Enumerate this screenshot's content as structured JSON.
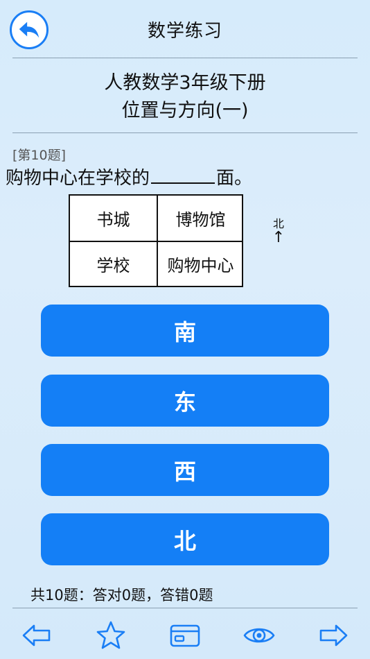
{
  "nav": {
    "title": "数学练习",
    "back_icon": "back-arrow-icon"
  },
  "book": {
    "line1": "人教数学3年级下册",
    "line2": "位置与方向(一)"
  },
  "question": {
    "number": "[第10题]",
    "text_before": "购物中心在学校的",
    "text_after": "面。",
    "grid": [
      [
        "书城",
        "博物馆"
      ],
      [
        "学校",
        "购物中心"
      ]
    ],
    "north_label": "北",
    "north_arrow": "↑"
  },
  "options": [
    "南",
    "东",
    "西",
    "北"
  ],
  "stats": "共10题：答对0题，答错0题",
  "toolbar": [
    "prev-arrow-icon",
    "star-icon",
    "card-icon",
    "eye-icon",
    "next-arrow-icon"
  ],
  "colors": {
    "accent": "#147ff6",
    "background": "#d6ebfb"
  }
}
